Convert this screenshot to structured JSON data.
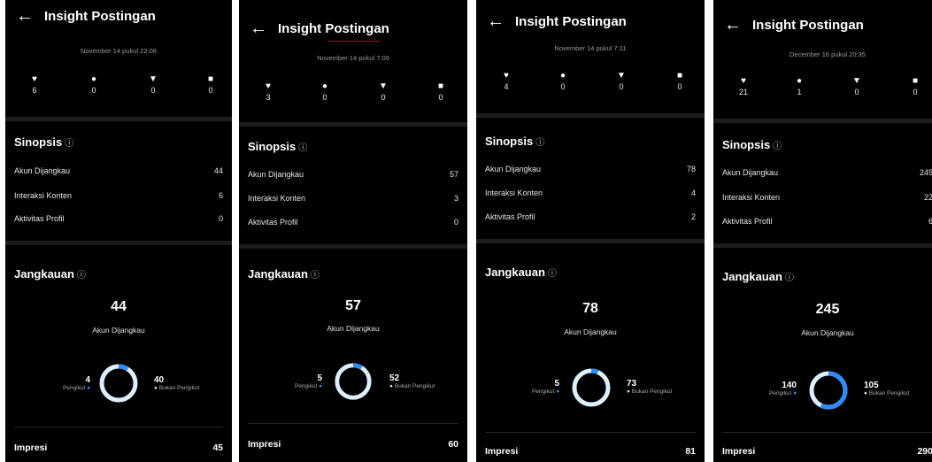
{
  "common": {
    "back_icon": "arrow-left-icon",
    "title": "Insight Postingan",
    "sinopsis_title": "Sinopsis",
    "jangkauan_title": "Jangkauan",
    "info_icon": "ⓘ",
    "row_labels": [
      "Akun Dijangkau",
      "Interaksi Konten",
      "Aktivitas Profil"
    ],
    "reach_sub": "Akun Dijangkau",
    "follower_label": "Pengikut",
    "nonfollower_label": "Bukan Pengikut",
    "impresi_label": "Impresi",
    "colors": {
      "follower": "#2f8cff",
      "nonfollower": "#ddeefe",
      "background": "#000000"
    }
  },
  "panels": [
    {
      "date": "November 14 pukul 22:08",
      "stats": {
        "likes": "6",
        "comments": "0",
        "shares": "0",
        "saves": "0"
      },
      "sinopsis": [
        "44",
        "6",
        "0"
      ],
      "reach": {
        "total": "44",
        "followers": "4",
        "non_followers": "40"
      },
      "impresi": "45"
    },
    {
      "date": "November 14 pukul 7:09",
      "stats": {
        "likes": "3",
        "comments": "0",
        "shares": "0",
        "saves": "0"
      },
      "sinopsis": [
        "57",
        "3",
        "0"
      ],
      "reach": {
        "total": "57",
        "followers": "5",
        "non_followers": "52"
      },
      "impresi": "60"
    },
    {
      "date": "November 14 pukul 7:11",
      "stats": {
        "likes": "4",
        "comments": "0",
        "shares": "0",
        "saves": "0"
      },
      "sinopsis": [
        "78",
        "4",
        "2"
      ],
      "reach": {
        "total": "78",
        "followers": "5",
        "non_followers": "73"
      },
      "impresi": "81"
    },
    {
      "date": "December 16 pukul 20:35",
      "stats": {
        "likes": "21",
        "comments": "1",
        "shares": "0",
        "saves": "0"
      },
      "sinopsis": [
        "245",
        "22",
        "6"
      ],
      "reach": {
        "total": "245",
        "followers": "140",
        "non_followers": "105"
      },
      "impresi": "290"
    }
  ]
}
